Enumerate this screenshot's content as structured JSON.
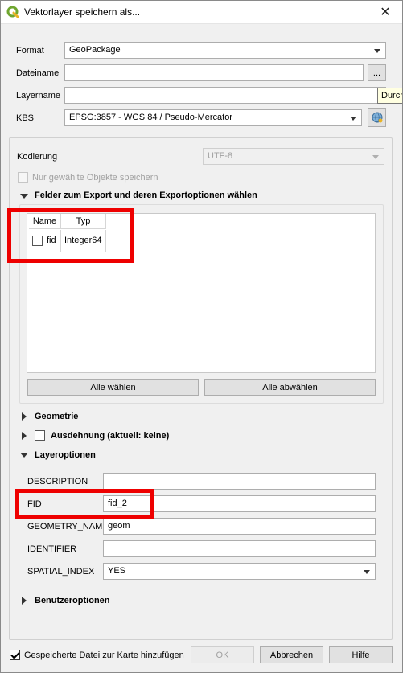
{
  "window": {
    "title": "Vektorlayer speichern als...",
    "close": "✕"
  },
  "form": {
    "format_label": "Format",
    "format_value": "GeoPackage",
    "filename_label": "Dateiname",
    "filename_value": "",
    "browse_label": "...",
    "layername_label": "Layername",
    "layername_value": "",
    "crs_label": "KBS",
    "crs_value": "EPSG:3857 - WGS 84 / Pseudo-Mercator"
  },
  "tooltip": "Durch",
  "encoding": {
    "label": "Kodierung",
    "value": "UTF-8"
  },
  "only_selected_label": "Nur gewählte Objekte speichern",
  "fields_section": {
    "title": "Felder zum Export und deren Exportoptionen wählen",
    "columns": [
      "Name",
      "Typ"
    ],
    "rows": [
      {
        "name": "fid",
        "type": "Integer64",
        "checked": false
      }
    ],
    "select_all": "Alle wählen",
    "deselect_all": "Alle abwählen"
  },
  "geometry_section": "Geometrie",
  "extent_section": "Ausdehnung (aktuell: keine)",
  "layer_options": {
    "title": "Layeroptionen",
    "description_label": "DESCRIPTION",
    "description_value": "",
    "fid_label": "FID",
    "fid_value": "fid_2",
    "geometry_name_label": "GEOMETRY_NAME",
    "geometry_name_value": "geom",
    "identifier_label": "IDENTIFIER",
    "identifier_value": "",
    "spatial_index_label": "SPATIAL_INDEX",
    "spatial_index_value": "YES"
  },
  "user_options": "Benutzeroptionen",
  "footer": {
    "add_to_map_label": "Gespeicherte Datei zur Karte hinzufügen",
    "ok": "OK",
    "cancel": "Abbrechen",
    "help": "Hilfe"
  },
  "colors": {
    "highlight": "#ee0000",
    "qgis_green": "#6fa62f"
  }
}
